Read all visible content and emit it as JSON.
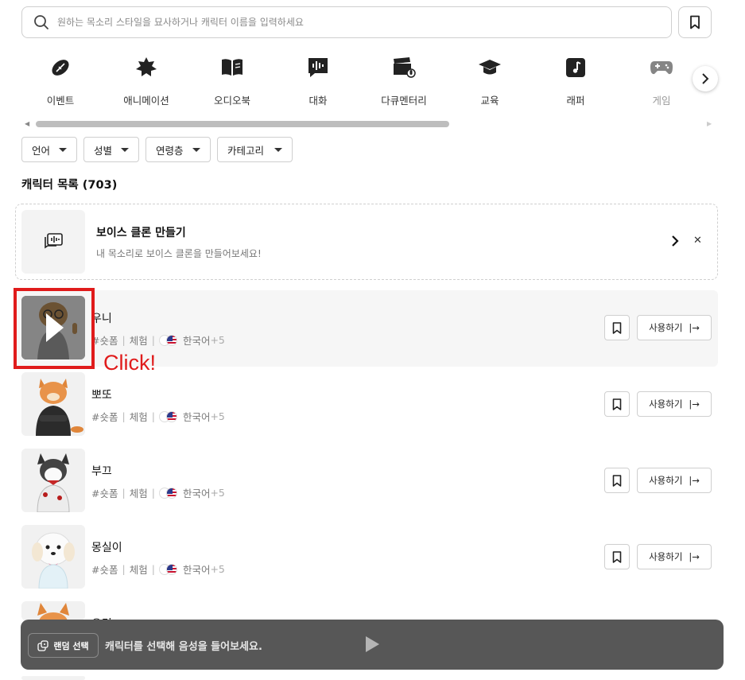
{
  "search": {
    "placeholder": "원하는 목소리 스타일을 묘사하거나 캐릭터 이름을 입력하세요",
    "icon": "search-icon"
  },
  "categories": [
    {
      "label": "이벤트",
      "icon": "football-icon"
    },
    {
      "label": "애니메이션",
      "icon": "star-badge-icon"
    },
    {
      "label": "오디오북",
      "icon": "book-icon"
    },
    {
      "label": "대화",
      "icon": "chat-waveform-icon"
    },
    {
      "label": "다큐멘터리",
      "icon": "clapperboard-mic-icon"
    },
    {
      "label": "교육",
      "icon": "graduation-cap-icon"
    },
    {
      "label": "래퍼",
      "icon": "music-note-icon"
    },
    {
      "label": "게임",
      "icon": "gamepad-icon"
    }
  ],
  "filters": [
    "언어",
    "성별",
    "연령층",
    "카테고리"
  ],
  "list_title": "캐릭터 목록 (703)",
  "clone": {
    "title": "보이스 클론 만들기",
    "subtitle": "내 목소리로 보이스 클론을 만들어보세요!"
  },
  "characters": [
    {
      "name": "우니",
      "tag": "#숏폼",
      "type": "체험",
      "lang": "한국어",
      "extra": "+5"
    },
    {
      "name": "뽀또",
      "tag": "#숏폼",
      "type": "체험",
      "lang": "한국어",
      "extra": "+5"
    },
    {
      "name": "부끄",
      "tag": "#숏폼",
      "type": "체험",
      "lang": "한국어",
      "extra": "+5"
    },
    {
      "name": "몽실이",
      "tag": "#숏폼",
      "type": "체험",
      "lang": "한국어",
      "extra": "+5"
    },
    {
      "name": "유리",
      "tag": "",
      "type": "",
      "lang": "",
      "extra": ""
    }
  ],
  "use_label": "사용하기",
  "annotation": "Click!",
  "player": {
    "random_label": "랜덤 선택",
    "prompt": "캐릭터를 선택해 음성을 들어보세요."
  },
  "colors": {
    "highlight": "#e01b1b",
    "player_bg": "#575757"
  }
}
